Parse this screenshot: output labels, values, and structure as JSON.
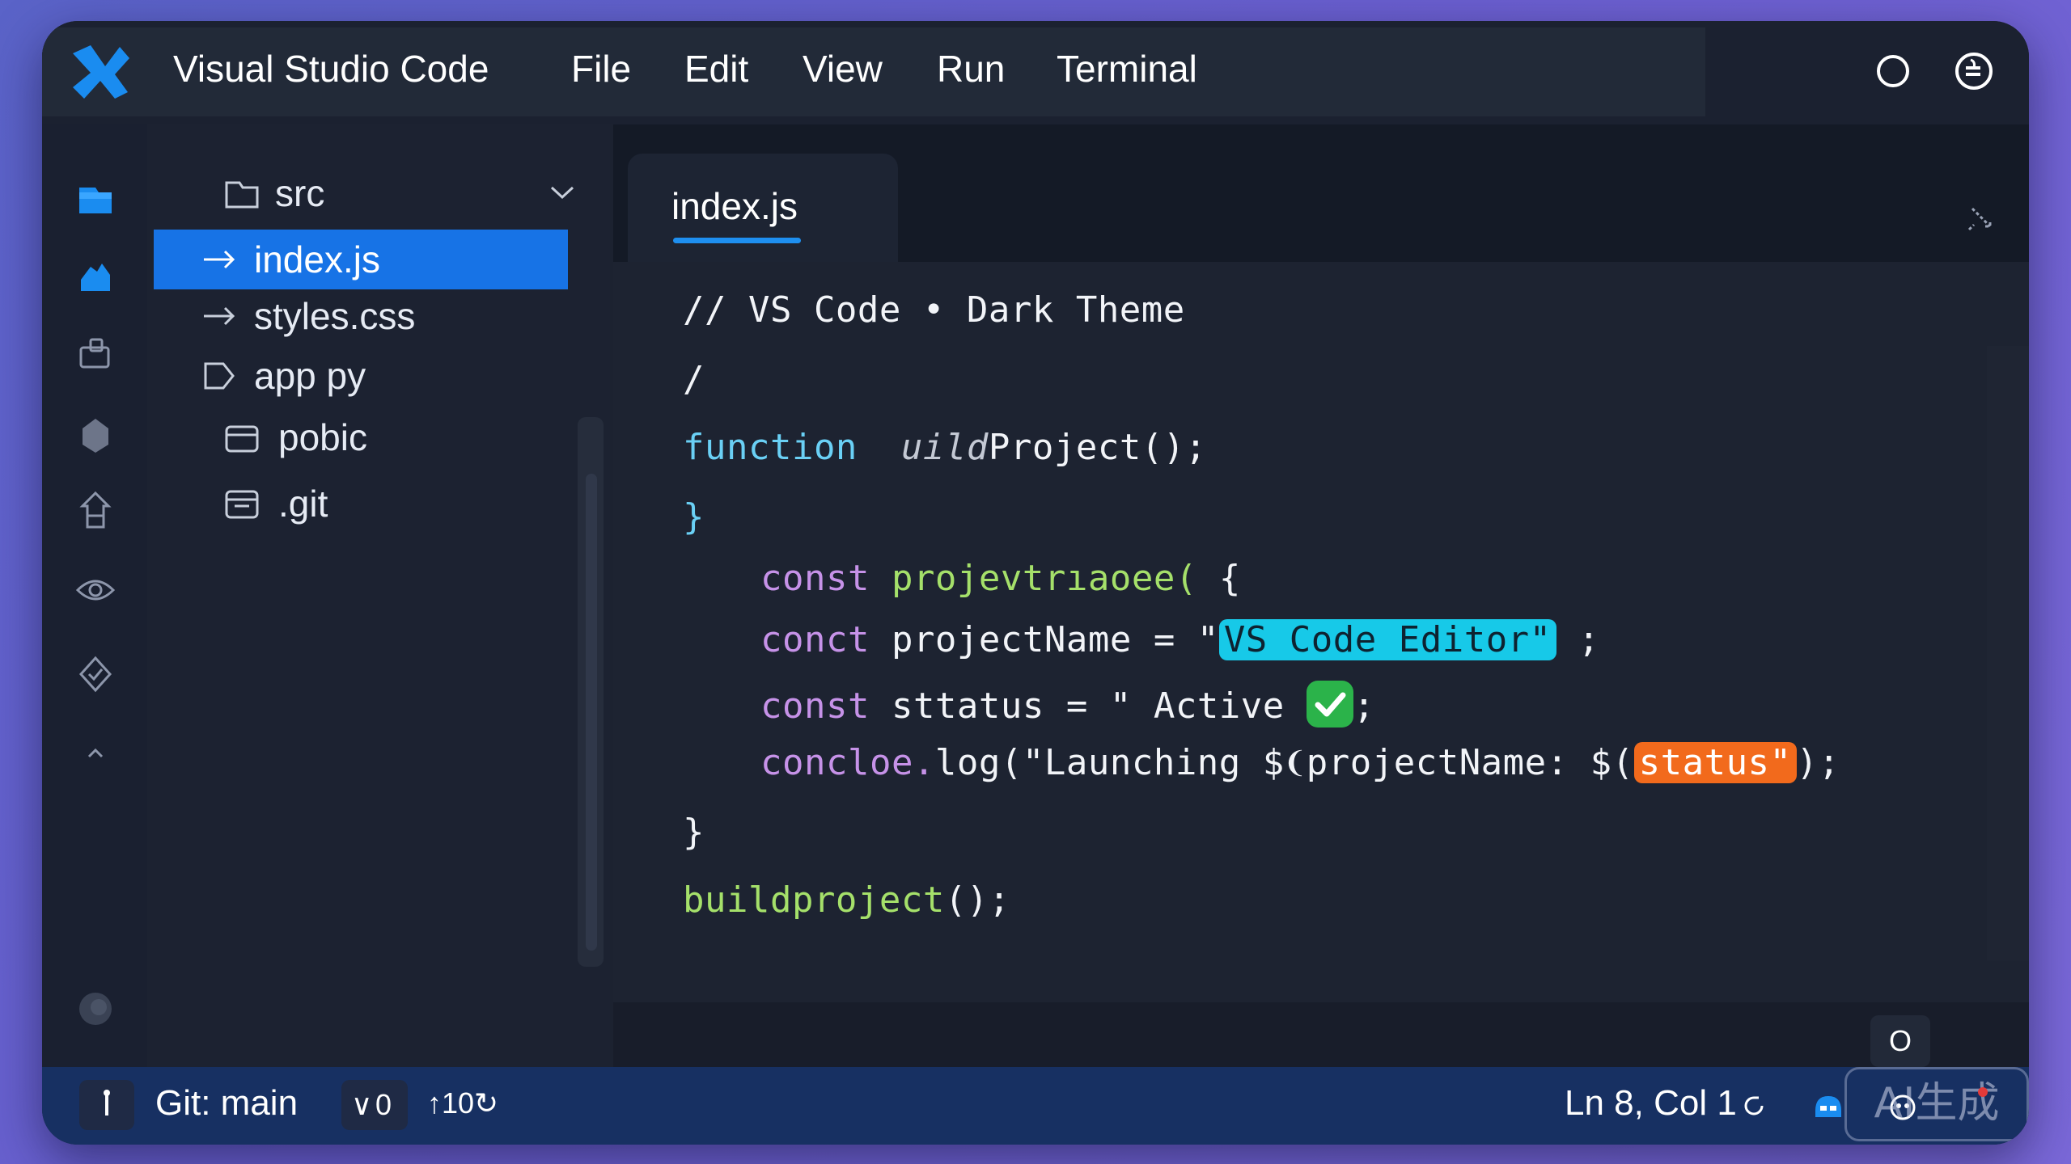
{
  "app": {
    "title": "Visual Studio Code",
    "menu": [
      "File",
      "Edit",
      "View",
      "Run",
      "Terminal"
    ],
    "accent": "#1773e6"
  },
  "activity_bar": [
    "explorer-icon",
    "search-icon",
    "source-control-icon",
    "debug-icon",
    "extensions-icon",
    "remote-explorer-icon",
    "testing-icon",
    "collapse-icon",
    "account-icon"
  ],
  "explorer": {
    "items": [
      {
        "label": "src",
        "icon": "folder-icon"
      },
      {
        "label": "index.js",
        "icon": "arrow-right-icon",
        "selected": true
      },
      {
        "label": "styles.css",
        "icon": "arrow-right-icon"
      },
      {
        "label": "app py",
        "icon": "file-icon"
      },
      {
        "label": "pobic",
        "icon": "folder-icon"
      },
      {
        "label": ".git",
        "icon": "folder-icon"
      }
    ]
  },
  "editor": {
    "tab": "index.js",
    "code": {
      "l1": "// VS Code • Dark Theme",
      "l2": "/",
      "l3_kw": "function",
      "l3_name_a": "uild",
      "l3_name_b": "Project();",
      "l4": "}",
      "l5_kw": "const",
      "l5_rest": "projevtrıaoee(",
      "l5_end": "{",
      "l6_kw": "conct",
      "l6_mid": "projectName = \"",
      "l6_str": "VS Code Editor\"",
      "l6_end": " ;",
      "l7_kw": "const",
      "l7_mid": "sttatus = \" Active",
      "l7_end": ";",
      "l8_kw": "concloe.",
      "l8_mid": "log(\"Launching $❨projectName: $(",
      "l8_str": "status\"",
      "l8_end": ");",
      "l9": "}",
      "l10_fn": "buildproject",
      "l10_end": "();"
    },
    "bottom_badge": "O"
  },
  "status_bar": {
    "branch": "Git: main",
    "sync_down": "0",
    "sync_up": "10",
    "position": "Ln 8, Col 1",
    "watermark": "AI生成"
  },
  "colors": {
    "keyword": "#6ad0f5",
    "keyword2": "#c692e8",
    "function": "#a5e06a",
    "highlight_cyan": "#17c9e8",
    "highlight_orange": "#f26a1c",
    "statusbar": "#173062"
  }
}
